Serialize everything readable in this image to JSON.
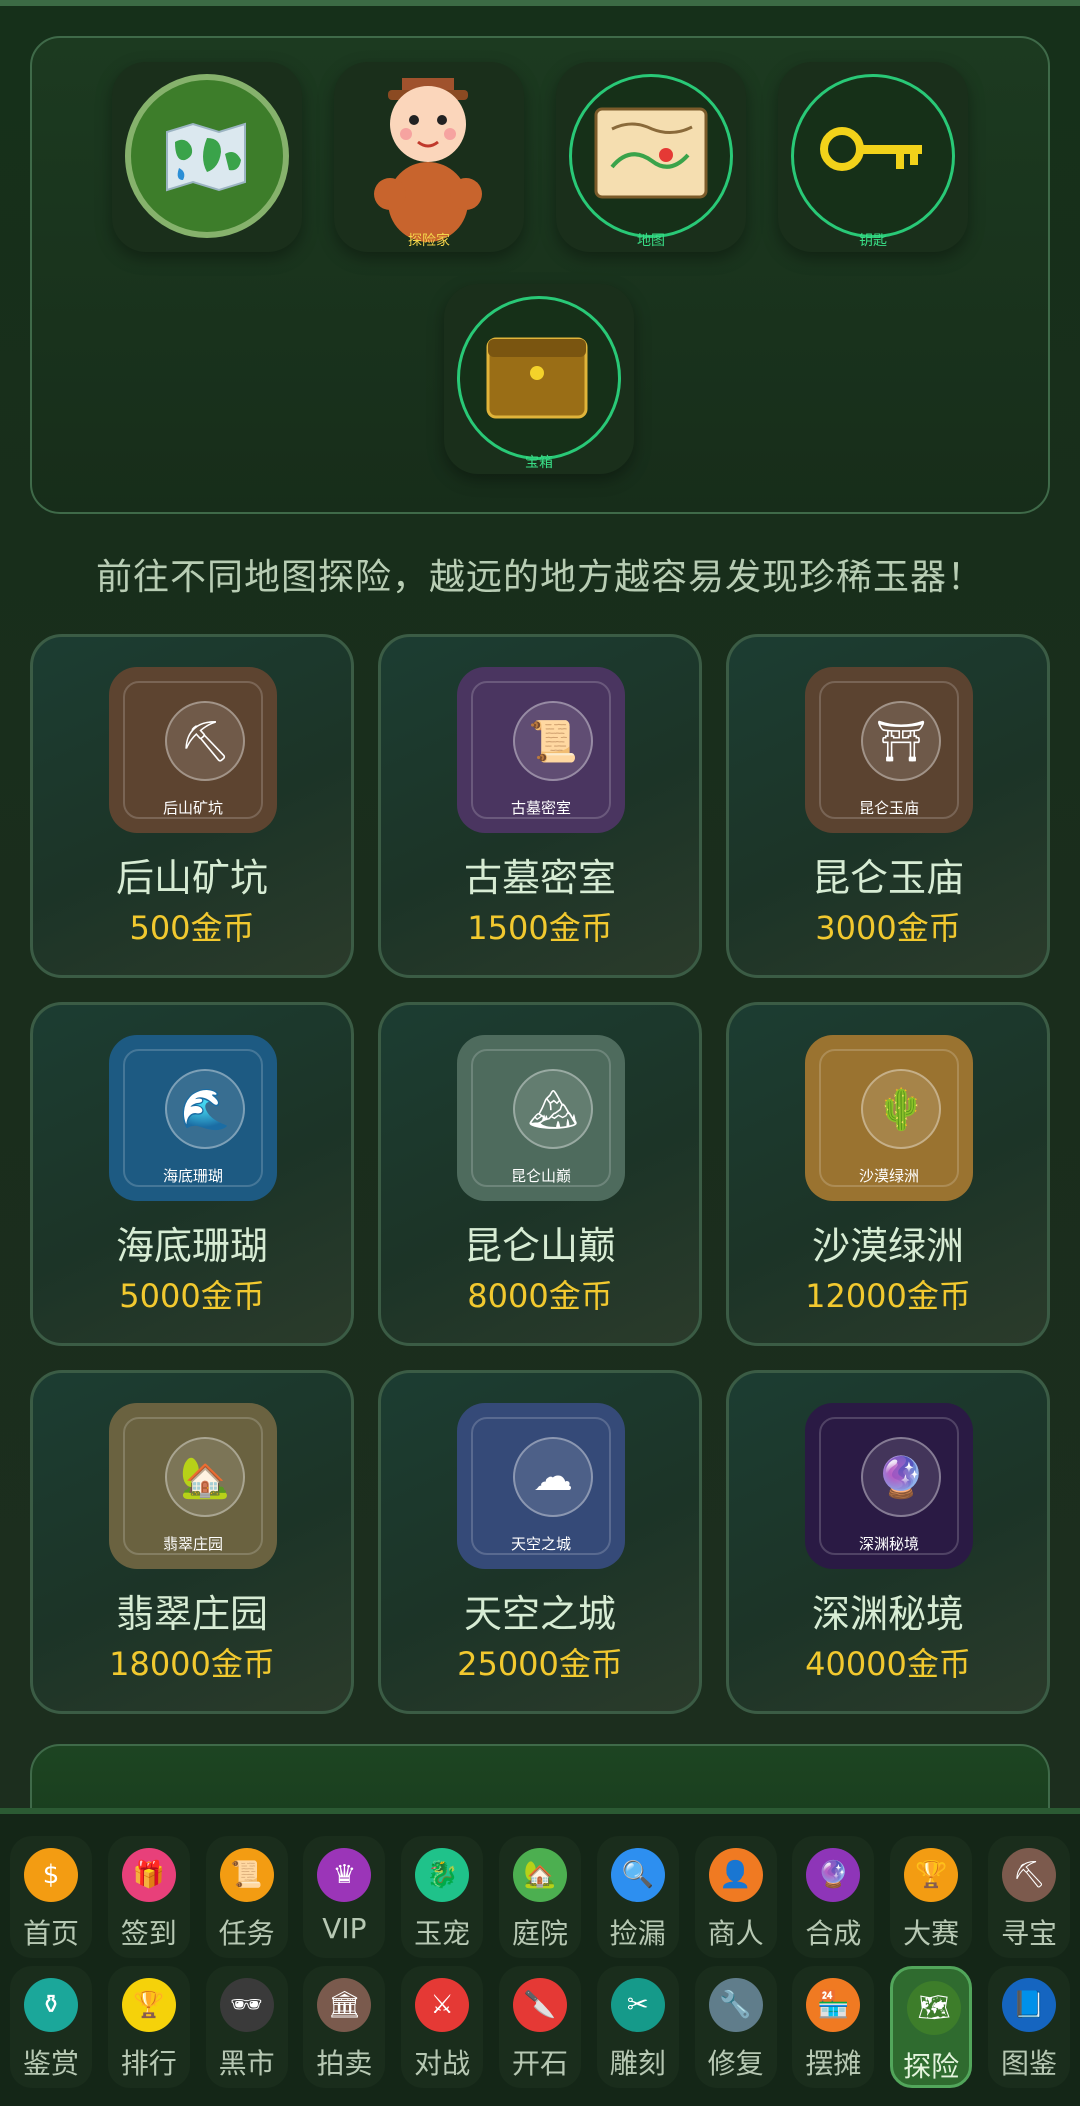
{
  "items": {
    "explorer_label": "探险家",
    "map_label": "地图",
    "key_label": "钥匙",
    "chest_label": "宝箱"
  },
  "hint": "前往不同地图探险，越远的地方越容易发现珍稀玉器！",
  "maps": [
    {
      "thumb_label": "后山矿坑",
      "name": "后山矿坑",
      "price": "500金币",
      "icon": "pickaxe-icon",
      "glyph": "⛏",
      "bg": "#5d4430"
    },
    {
      "thumb_label": "古墓密室",
      "name": "古墓密室",
      "price": "1500金币",
      "icon": "scroll-icon",
      "glyph": "📜",
      "bg": "#4a3560"
    },
    {
      "thumb_label": "昆仑玉庙",
      "name": "昆仑玉庙",
      "price": "3000金币",
      "icon": "torii-gate-icon",
      "glyph": "⛩",
      "bg": "#5b4330"
    },
    {
      "thumb_label": "海底珊瑚",
      "name": "海底珊瑚",
      "price": "5000金币",
      "icon": "wave-icon",
      "glyph": "🌊",
      "bg": "#1d5a82"
    },
    {
      "thumb_label": "昆仑山巅",
      "name": "昆仑山巅",
      "price": "8000金币",
      "icon": "mountain-icon",
      "glyph": "🏔",
      "bg": "#4e6b5d"
    },
    {
      "thumb_label": "沙漠绿洲",
      "name": "沙漠绿洲",
      "price": "12000金币",
      "icon": "cactus-icon",
      "glyph": "🌵",
      "bg": "#9a7330"
    },
    {
      "thumb_label": "翡翠庄园",
      "name": "翡翠庄园",
      "price": "18000金币",
      "icon": "house-icon",
      "glyph": "🏡",
      "bg": "#6a6240"
    },
    {
      "thumb_label": "天空之城",
      "name": "天空之城",
      "price": "25000金币",
      "icon": "cloud-icon",
      "glyph": "☁",
      "bg": "#354a78"
    },
    {
      "thumb_label": "深渊秘境",
      "name": "深渊秘境",
      "price": "40000金币",
      "icon": "crystal-ball-icon",
      "glyph": "🔮",
      "bg": "#2a1a44"
    }
  ],
  "nav_row1": [
    {
      "label": "首页",
      "icon": "money-bag-icon",
      "glyph": "$",
      "color": "#f39c12"
    },
    {
      "label": "签到",
      "icon": "gift-icon",
      "glyph": "🎁",
      "color": "#e8407a"
    },
    {
      "label": "任务",
      "icon": "scroll-icon",
      "glyph": "📜",
      "color": "#f39c12"
    },
    {
      "label": "VIP",
      "icon": "crown-icon",
      "glyph": "♛",
      "color": "#9b35b8"
    },
    {
      "label": "玉宠",
      "icon": "dragon-icon",
      "glyph": "🐉",
      "color": "#1fc28a"
    },
    {
      "label": "庭院",
      "icon": "house-icon",
      "glyph": "🏡",
      "color": "#4caf50"
    },
    {
      "label": "捡漏",
      "icon": "magnifier-icon",
      "glyph": "🔍",
      "color": "#2d8ff0"
    },
    {
      "label": "商人",
      "icon": "merchant-icon",
      "glyph": "👤",
      "color": "#f07a22"
    },
    {
      "label": "合成",
      "icon": "crystal-ball-icon",
      "glyph": "🔮",
      "color": "#8e35b8"
    },
    {
      "label": "大赛",
      "icon": "trophy-icon",
      "glyph": "🏆",
      "color": "#f39c12"
    },
    {
      "label": "寻宝",
      "icon": "pickaxe-icon",
      "glyph": "⛏",
      "color": "#7c5a4d"
    }
  ],
  "nav_row2": [
    {
      "label": "鉴赏",
      "icon": "vase-icon",
      "glyph": "⚱",
      "color": "#1ba79a",
      "active": false
    },
    {
      "label": "排行",
      "icon": "trophy-icon",
      "glyph": "🏆",
      "color": "#f5d20a",
      "active": false
    },
    {
      "label": "黑市",
      "icon": "sunglasses-icon",
      "glyph": "🕶",
      "color": "#3a3a3a",
      "active": false
    },
    {
      "label": "拍卖",
      "icon": "bank-icon",
      "glyph": "🏛",
      "color": "#7a5a4d",
      "active": false
    },
    {
      "label": "对战",
      "icon": "crossed-swords-icon",
      "glyph": "⚔",
      "color": "#e53935",
      "active": false
    },
    {
      "label": "开石",
      "icon": "knife-icon",
      "glyph": "🔪",
      "color": "#e53935",
      "active": false
    },
    {
      "label": "雕刻",
      "icon": "scissors-icon",
      "glyph": "✂",
      "color": "#159a8a",
      "active": false
    },
    {
      "label": "修复",
      "icon": "wrench-icon",
      "glyph": "🔧",
      "color": "#607d8b",
      "active": false
    },
    {
      "label": "摆摊",
      "icon": "shop-icon",
      "glyph": "🏪",
      "color": "#f07a22",
      "active": false
    },
    {
      "label": "探险",
      "icon": "map-icon",
      "glyph": "🗺",
      "color": "#3d7d2a",
      "active": true
    },
    {
      "label": "图鉴",
      "icon": "book-icon",
      "glyph": "📘",
      "color": "#1565c0",
      "active": false
    }
  ]
}
